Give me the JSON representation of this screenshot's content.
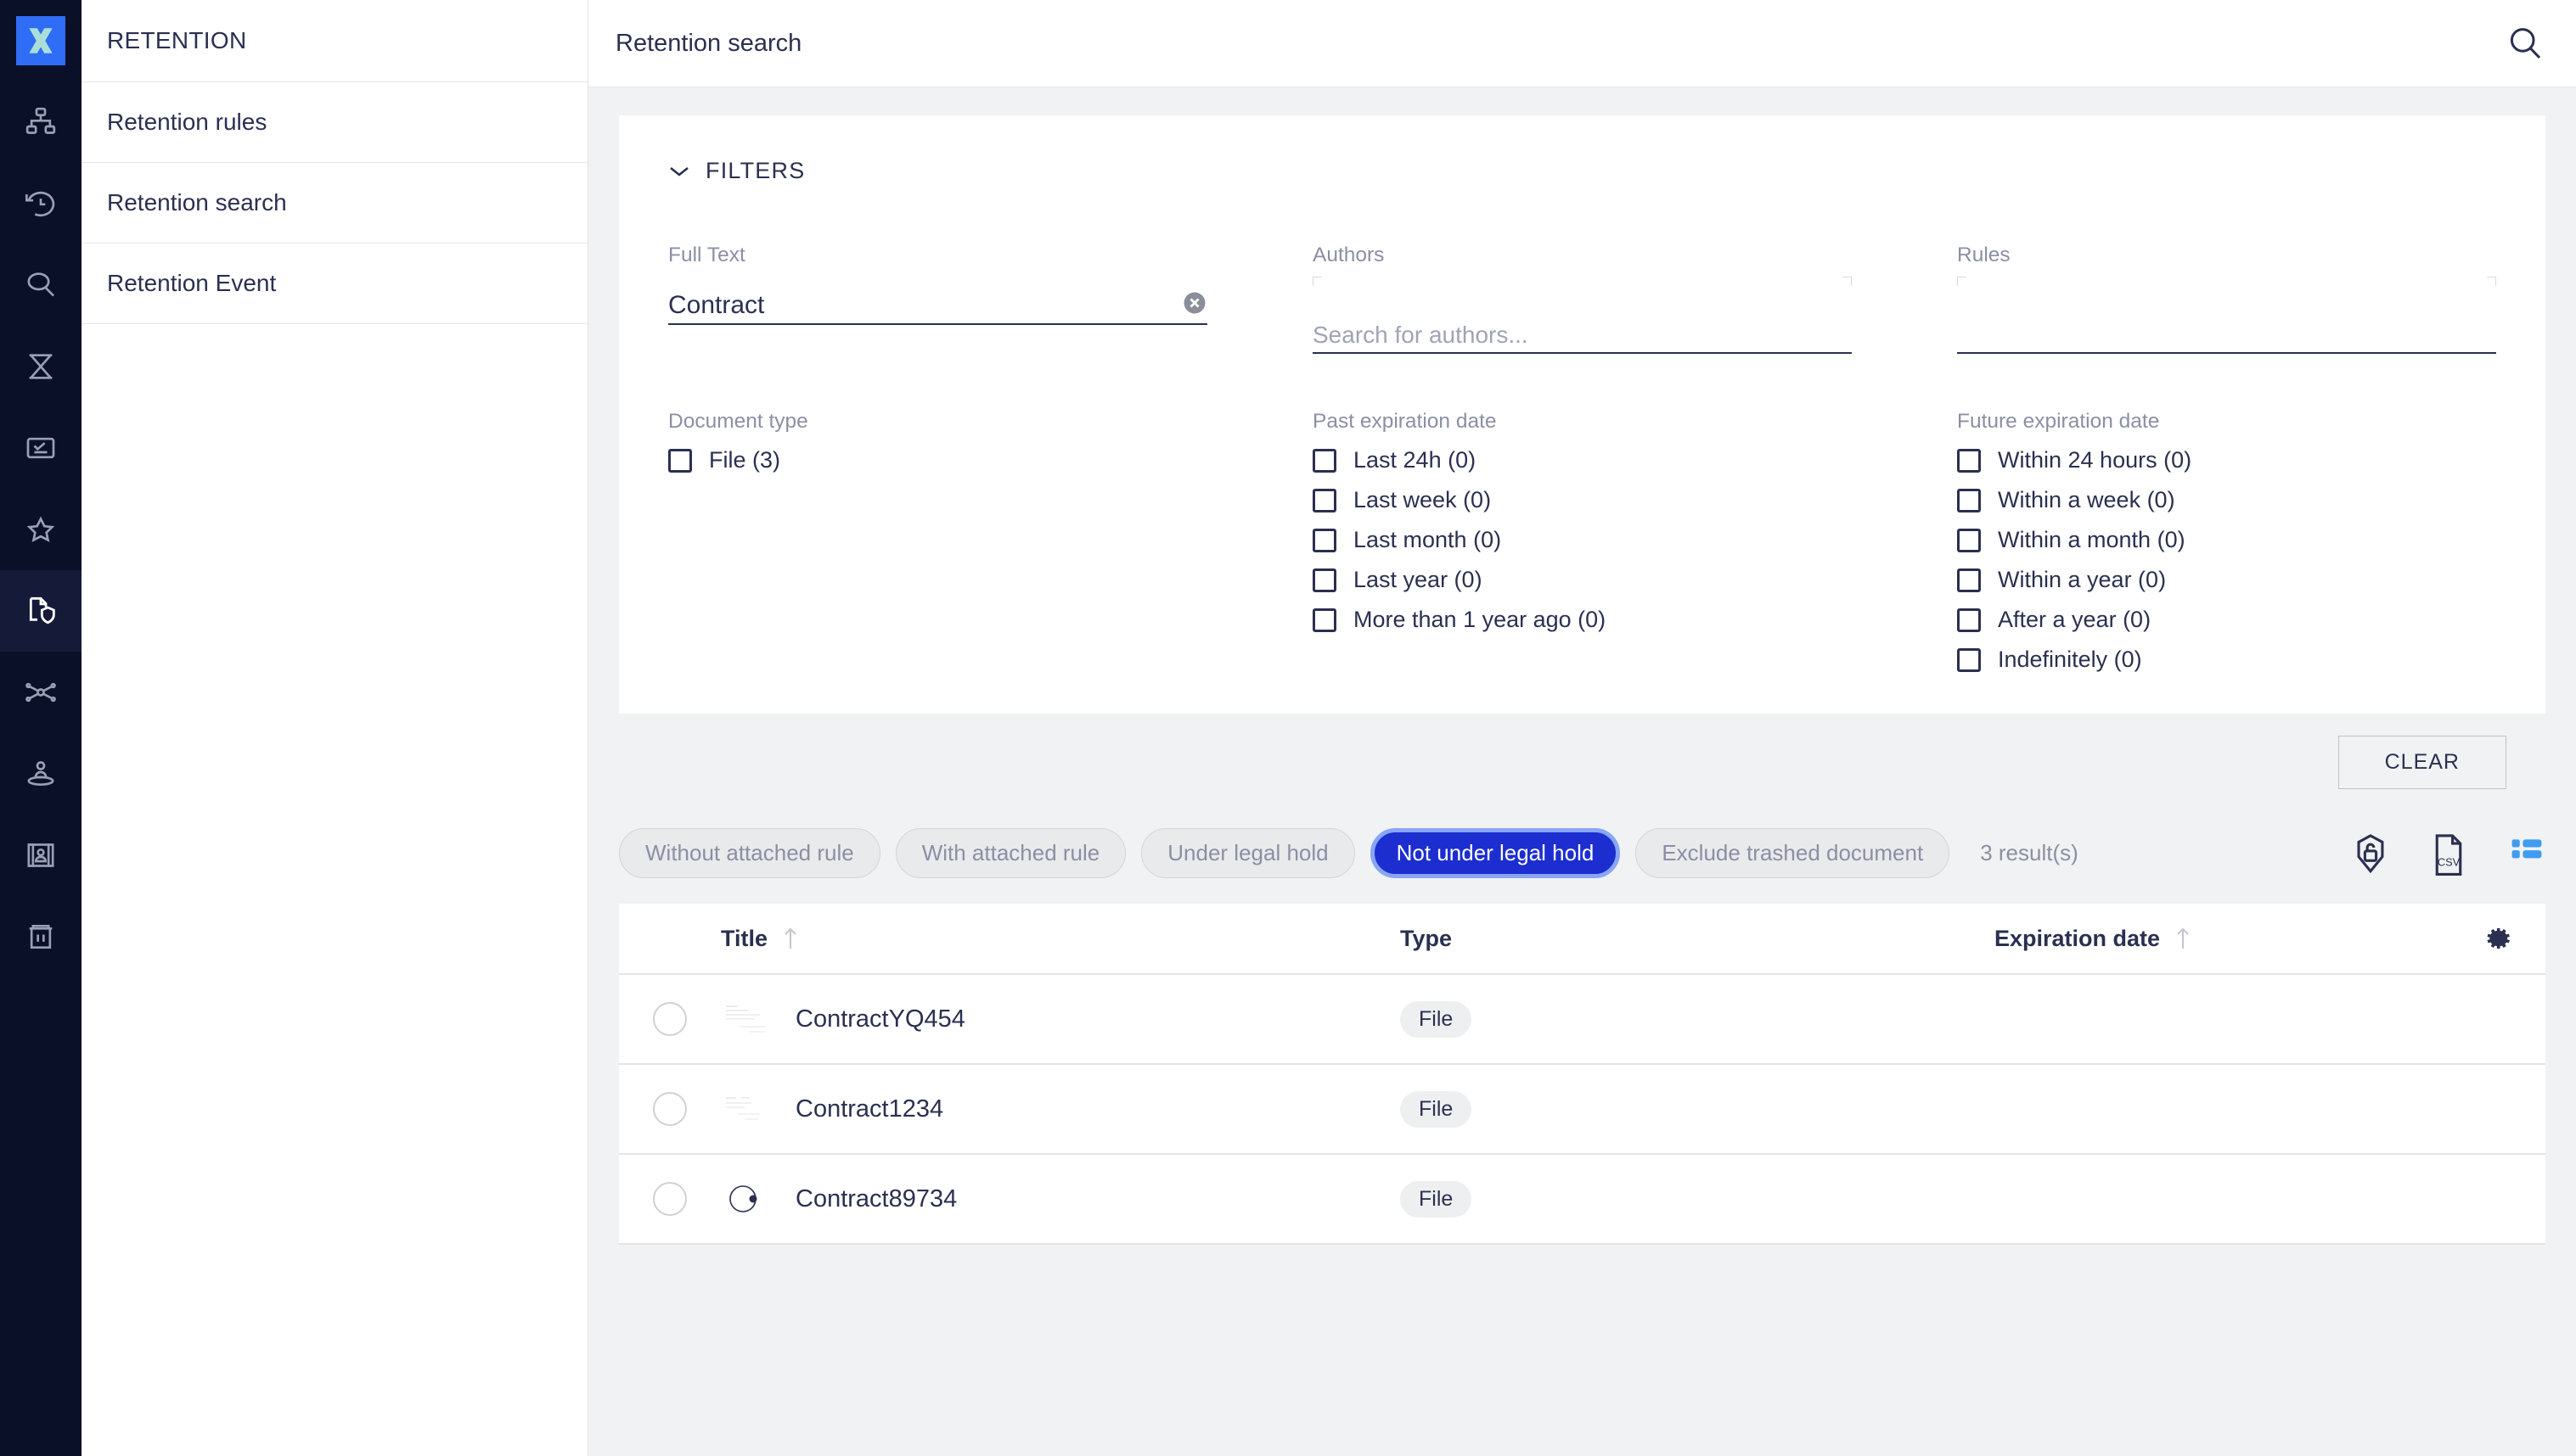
{
  "brand": {
    "logo_icon": "nuxeo-x-logo",
    "logo_bg": "#2f6df6",
    "logo_mark": "#a9dfd8",
    "rail_bg": "#0b1029",
    "accent": "#1c2ecf"
  },
  "rail": {
    "items": [
      {
        "icon": "hierarchy-icon",
        "name": "rail-item-hierarchy",
        "active": false
      },
      {
        "icon": "history-icon",
        "name": "rail-item-history",
        "active": false
      },
      {
        "icon": "search-icon",
        "name": "rail-item-search",
        "active": false
      },
      {
        "icon": "hourglass-icon",
        "name": "rail-item-tasks",
        "active": false
      },
      {
        "icon": "checklist-icon",
        "name": "rail-item-checklist",
        "active": false
      },
      {
        "icon": "star-icon",
        "name": "rail-item-favorites",
        "active": false
      },
      {
        "icon": "document-shield-icon",
        "name": "rail-item-retention",
        "active": true
      },
      {
        "icon": "relations-icon",
        "name": "rail-item-relations",
        "active": false
      },
      {
        "icon": "user-pin-icon",
        "name": "rail-item-users",
        "active": false
      },
      {
        "icon": "id-card-icon",
        "name": "rail-item-vocabulary",
        "active": false
      },
      {
        "icon": "trash-icon",
        "name": "rail-item-trash",
        "active": false
      }
    ]
  },
  "subnav": {
    "title": "RETENTION",
    "items": [
      {
        "label": "Retention rules",
        "selected": false
      },
      {
        "label": "Retention search",
        "selected": true
      },
      {
        "label": "Retention Event",
        "selected": false
      }
    ]
  },
  "topbar": {
    "title": "Retention search",
    "search_icon": "search-icon"
  },
  "filters": {
    "heading": "FILTERS",
    "chevron_icon": "chevron-down-icon",
    "full_text": {
      "label": "Full Text",
      "value": "Contract",
      "clear_icon": "clear-circle-icon"
    },
    "authors": {
      "label": "Authors",
      "value": "",
      "placeholder": "Search for authors..."
    },
    "rules": {
      "label": "Rules",
      "value": "",
      "placeholder": ""
    },
    "document_type": {
      "label": "Document type",
      "options": [
        {
          "label": "File (3)",
          "checked": false
        }
      ]
    },
    "past_expiration": {
      "label": "Past expiration date",
      "options": [
        {
          "label": "Last 24h (0)",
          "checked": false
        },
        {
          "label": "Last week (0)",
          "checked": false
        },
        {
          "label": "Last month (0)",
          "checked": false
        },
        {
          "label": "Last year (0)",
          "checked": false
        },
        {
          "label": "More than 1 year ago (0)",
          "checked": false
        }
      ]
    },
    "future_expiration": {
      "label": "Future expiration date",
      "options": [
        {
          "label": "Within 24 hours (0)",
          "checked": false
        },
        {
          "label": "Within a week (0)",
          "checked": false
        },
        {
          "label": "Within a month (0)",
          "checked": false
        },
        {
          "label": "Within a year (0)",
          "checked": false
        },
        {
          "label": "After a year (0)",
          "checked": false
        },
        {
          "label": "Indefinitely (0)",
          "checked": false
        }
      ]
    },
    "clear_button": "CLEAR"
  },
  "quickfilters": {
    "chips": [
      {
        "label": "Without attached rule",
        "active": false
      },
      {
        "label": "With attached rule",
        "active": false
      },
      {
        "label": "Under legal hold",
        "active": false
      },
      {
        "label": "Not under legal hold",
        "active": true
      },
      {
        "label": "Exclude trashed document",
        "active": false
      }
    ],
    "results_count": "3 result(s)",
    "tools": [
      {
        "icon": "unlock-hold-icon",
        "name": "legal-hold-toggle-button"
      },
      {
        "icon": "csv-export-icon",
        "name": "export-csv-button"
      },
      {
        "icon": "list-view-icon",
        "name": "display-mode-button"
      }
    ]
  },
  "table": {
    "columns": [
      {
        "label": "Title",
        "sortable": true
      },
      {
        "label": "Type",
        "sortable": false
      },
      {
        "label": "Expiration date",
        "sortable": true
      }
    ],
    "settings_icon": "gear-icon",
    "rows": [
      {
        "title": "ContractYQ454",
        "type": "File",
        "expiration": "",
        "thumb": "document-thumbnail",
        "selected": false
      },
      {
        "title": "Contract1234",
        "type": "File",
        "expiration": "",
        "thumb": "document-thumbnail",
        "selected": false
      },
      {
        "title": "Contract89734",
        "type": "File",
        "expiration": "",
        "thumb": "loading-spinner",
        "selected": false
      }
    ]
  }
}
